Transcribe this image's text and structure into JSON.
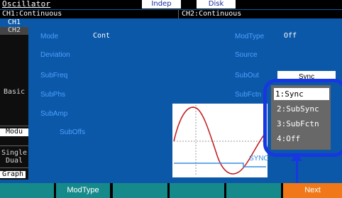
{
  "title_bar": {
    "title": "Oscillator",
    "indep": "Indep",
    "disk": "Disk"
  },
  "channels": {
    "ch1": "CH1:Continuous",
    "ch2": "CH2:Continuous"
  },
  "nav": {
    "ch1": "CH1",
    "ch2": "CH2",
    "basic": "Basic",
    "modu": "Modu",
    "single": "Single",
    "dual": "Dual",
    "graph": "Graph"
  },
  "params_left": {
    "mode_label": "Mode",
    "mode_value": "Cont",
    "deviation_label": "Deviation",
    "subfreq_label": "SubFreq",
    "subphs_label": "SubPhs",
    "subamp_label": "SubAmp",
    "suboffs_label": "SubOffs"
  },
  "params_right": {
    "modtype_label": "ModType",
    "modtype_value": "Off",
    "source_label": "Source",
    "subout_label": "SubOut",
    "subout_value": "Sync",
    "subfctn_label": "SubFctn"
  },
  "graph": {
    "sync_label": "SYNC"
  },
  "dropdown": {
    "selected_index": 0,
    "options": [
      "1:Sync",
      "2:SubSync",
      "3:SubFctn",
      "4:Off"
    ]
  },
  "softkeys": {
    "k1": "",
    "k2": "ModType",
    "k3": "",
    "k4": "",
    "k5": "",
    "k6": "Next"
  },
  "colors": {
    "background": "#0c58a8",
    "label": "#4aa0ff",
    "softkey": "#168a8a",
    "next_key": "#f07818",
    "highlight_ring": "#1737e0",
    "waveform": "#c01818"
  }
}
